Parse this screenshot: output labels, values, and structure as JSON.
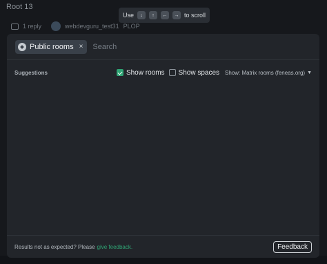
{
  "background": {
    "room_title": "Root 13",
    "thread_reply": "1 reply",
    "thread_author": "webdevguru_test31",
    "thread_preview": "PLOP"
  },
  "scroll_hint": {
    "prefix": "Use",
    "keys": [
      "↓",
      "↑",
      "←",
      "→"
    ],
    "suffix": "to scroll"
  },
  "search": {
    "chip_label": "Public rooms",
    "chip_close": "×",
    "placeholder": "Search",
    "value": ""
  },
  "suggestions": {
    "title": "Suggestions",
    "show_rooms_label": "Show rooms",
    "show_rooms_checked": true,
    "show_spaces_label": "Show spaces",
    "show_spaces_checked": false,
    "server_label": "Show: Matrix rooms (feneas.org)"
  },
  "footer": {
    "text": "Results not as expected? Please",
    "link": "give feedback.",
    "button": "Feedback"
  },
  "colors": {
    "accent": "#2fa474",
    "modal_bg": "#22252a",
    "chip_bg": "#394049"
  }
}
